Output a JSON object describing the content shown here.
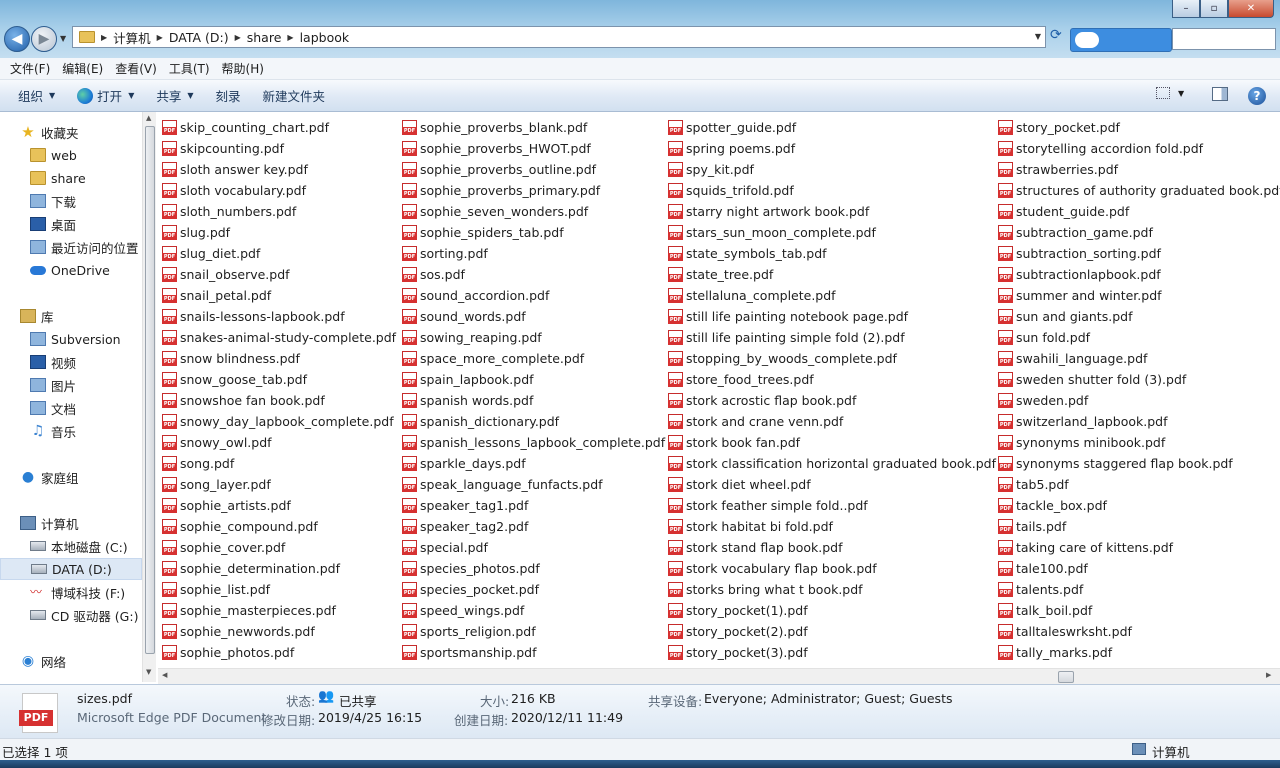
{
  "window": {
    "minimize": "–",
    "maximize": "▫",
    "close": "✕"
  },
  "address": {
    "crumbs": [
      "计算机",
      "DATA (D:)",
      "share",
      "lapbook"
    ]
  },
  "menubar": [
    "文件(F)",
    "编辑(E)",
    "查看(V)",
    "工具(T)",
    "帮助(H)"
  ],
  "toolbar": {
    "organize": "组织",
    "open": "打开",
    "share": "共享",
    "burn": "刻录",
    "new_folder": "新建文件夹",
    "help": "?"
  },
  "sidebar": {
    "favorites": "收藏夹",
    "favorite_items": [
      "web",
      "share",
      "下载",
      "桌面",
      "最近访问的位置",
      "OneDrive"
    ],
    "libraries": "库",
    "library_items": [
      "Subversion",
      "视频",
      "图片",
      "文档",
      "音乐"
    ],
    "homegroup": "家庭组",
    "computer": "计算机",
    "drives": [
      "本地磁盘 (C:)",
      "DATA (D:)",
      "博域科技 (F:)",
      "CD 驱动器 (G:)"
    ],
    "network": "网络"
  },
  "files": {
    "col1": [
      "skip_counting_chart.pdf",
      "skipcounting.pdf",
      "sloth answer key.pdf",
      "sloth vocabulary.pdf",
      "sloth_numbers.pdf",
      "slug.pdf",
      "slug_diet.pdf",
      "snail_observe.pdf",
      "snail_petal.pdf",
      "snails-lessons-lapbook.pdf",
      "snakes-animal-study-complete.pdf",
      "snow blindness.pdf",
      "snow_goose_tab.pdf",
      "snowshoe fan book.pdf",
      "snowy_day_lapbook_complete.pdf",
      "snowy_owl.pdf",
      "song.pdf",
      "song_layer.pdf",
      "sophie_artists.pdf",
      "sophie_compound.pdf",
      "sophie_cover.pdf",
      "sophie_determination.pdf",
      "sophie_list.pdf",
      "sophie_masterpieces.pdf",
      "sophie_newwords.pdf",
      "sophie_photos.pdf"
    ],
    "col2": [
      "sophie_proverbs_blank.pdf",
      "sophie_proverbs_HWOT.pdf",
      "sophie_proverbs_outline.pdf",
      "sophie_proverbs_primary.pdf",
      "sophie_seven_wonders.pdf",
      "sophie_spiders_tab.pdf",
      "sorting.pdf",
      "sos.pdf",
      "sound_accordion.pdf",
      "sound_words.pdf",
      "sowing_reaping.pdf",
      "space_more_complete.pdf",
      "spain_lapbook.pdf",
      "spanish words.pdf",
      "spanish_dictionary.pdf",
      "spanish_lessons_lapbook_complete.pdf",
      "sparkle_days.pdf",
      "speak_language_funfacts.pdf",
      "speaker_tag1.pdf",
      "speaker_tag2.pdf",
      "special.pdf",
      "species_photos.pdf",
      "species_pocket.pdf",
      "speed_wings.pdf",
      "sports_religion.pdf",
      "sportsmanship.pdf"
    ],
    "col3": [
      "spotter_guide.pdf",
      "spring poems.pdf",
      "spy_kit.pdf",
      "squids_trifold.pdf",
      "starry night artwork book.pdf",
      "stars_sun_moon_complete.pdf",
      "state_symbols_tab.pdf",
      "state_tree.pdf",
      "stellaluna_complete.pdf",
      "still life painting notebook page.pdf",
      "still life painting simple fold (2).pdf",
      "stopping_by_woods_complete.pdf",
      "store_food_trees.pdf",
      "stork acrostic flap book.pdf",
      "stork and crane venn.pdf",
      "stork book fan.pdf",
      "stork classification horizontal graduated book.pdf",
      "stork diet wheel.pdf",
      "stork feather simple fold..pdf",
      "stork habitat bi fold.pdf",
      "stork stand flap book.pdf",
      "stork vocabulary flap book.pdf",
      "storks bring what t book.pdf",
      "story_pocket(1).pdf",
      "story_pocket(2).pdf",
      "story_pocket(3).pdf"
    ],
    "col4": [
      "story_pocket.pdf",
      "storytelling accordion fold.pdf",
      "strawberries.pdf",
      "structures of authority graduated book.pdf",
      "student_guide.pdf",
      "subtraction_game.pdf",
      "subtraction_sorting.pdf",
      "subtractionlapbook.pdf",
      "summer and winter.pdf",
      "sun and giants.pdf",
      "sun fold.pdf",
      "swahili_language.pdf",
      "sweden shutter fold (3).pdf",
      "sweden.pdf",
      "switzerland_lapbook.pdf",
      "synonyms minibook.pdf",
      "synonyms staggered flap book.pdf",
      "tab5.pdf",
      "tackle_box.pdf",
      "tails.pdf",
      "taking care of kittens.pdf",
      "tale100.pdf",
      "talents.pdf",
      "talk_boil.pdf",
      "talltaleswrksht.pdf",
      "tally_marks.pdf"
    ]
  },
  "details": {
    "filename": "sizes.pdf",
    "filetype": "Microsoft Edge PDF Document",
    "pdf_label": "PDF",
    "state_label": "状态:",
    "state_value": "已共享",
    "modified_label": "修改日期:",
    "modified_value": "2019/4/25 16:15",
    "size_label": "大小:",
    "size_value": "216 KB",
    "created_label": "创建日期:",
    "created_value": "2020/12/11 11:49",
    "shared_label": "共享设备:",
    "shared_value": "Everyone; Administrator; Guest; Guests"
  },
  "status": {
    "selected": "已选择 1 项",
    "location": "计算机"
  },
  "colors": {
    "pdf_red": "#d63131",
    "selection": "#dde8f5"
  }
}
